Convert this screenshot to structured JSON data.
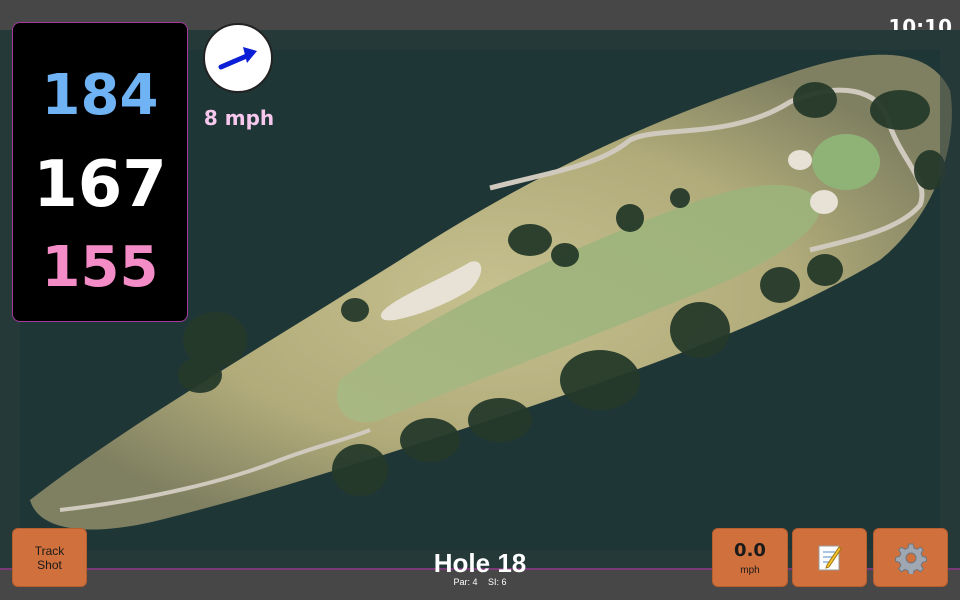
{
  "status": {
    "time": "10:10"
  },
  "distances": {
    "back": "184",
    "middle": "167",
    "front": "155"
  },
  "wind": {
    "speed": "8 mph",
    "icon": "wind-arrow-icon"
  },
  "hole": {
    "title": "Hole 18",
    "par": "Par: 4",
    "stroke_index": "SI: 6"
  },
  "buttons": {
    "track_shot": {
      "line1": "Track",
      "line2": "Shot"
    },
    "speed": {
      "value": "0.0",
      "unit": "mph"
    },
    "notes": {
      "icon": "notepad-icon"
    },
    "settings": {
      "icon": "gear-icon"
    }
  },
  "colors": {
    "back_distance": "#6fb3f4",
    "middle_distance": "#ffffff",
    "front_distance": "#f48dc7",
    "button_accent": "#d0703c",
    "wind_label": "#f7c8ee",
    "frame_accent": "#7a3a78"
  }
}
